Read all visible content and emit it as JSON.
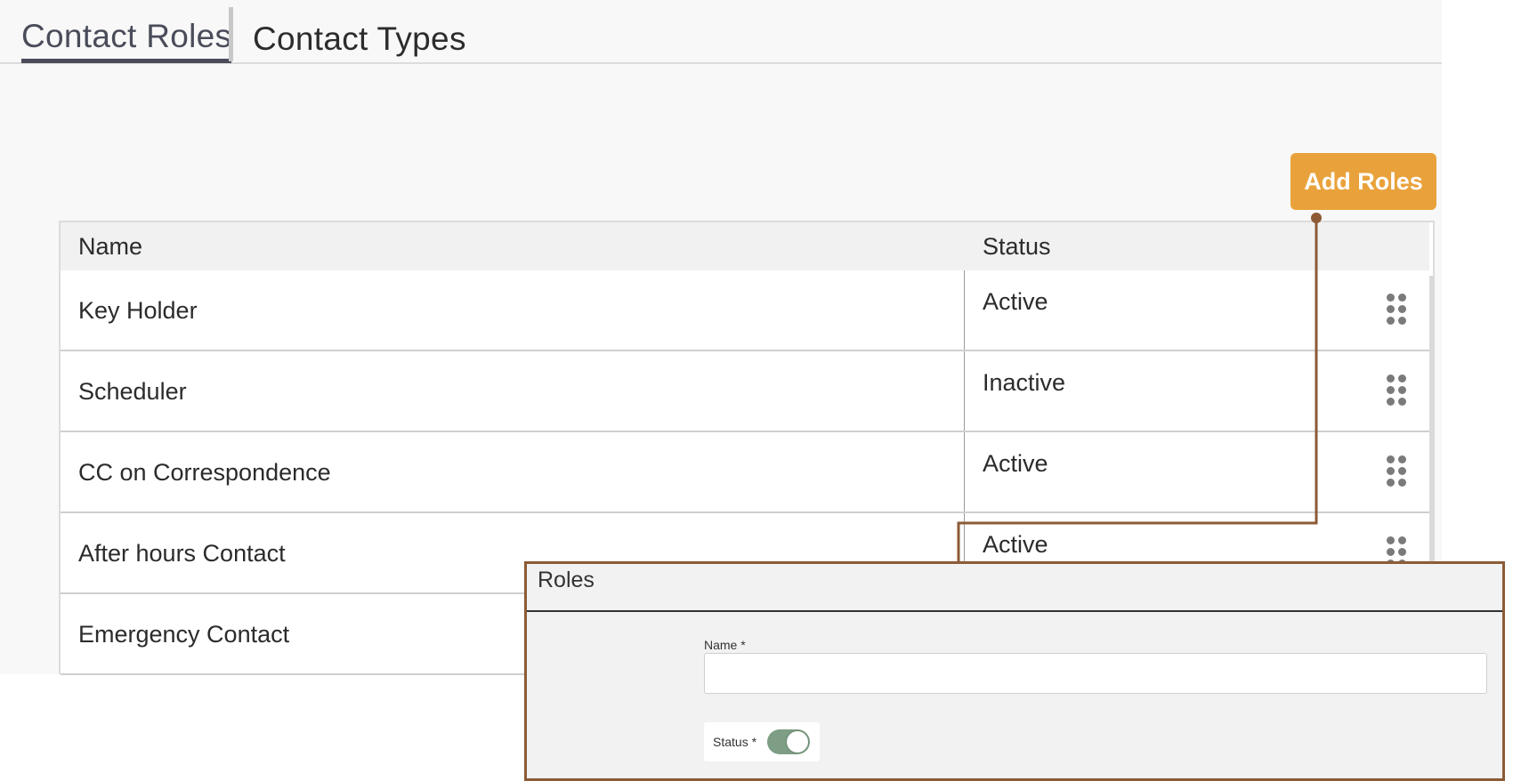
{
  "tabs": [
    {
      "label": "Contact Roles",
      "active": true
    },
    {
      "label": "Contact Types",
      "active": false
    }
  ],
  "toolbar": {
    "add_label": "Add Roles"
  },
  "table": {
    "headers": {
      "name": "Name",
      "status": "Status"
    },
    "rows": [
      {
        "name": "Key Holder",
        "status": "Active"
      },
      {
        "name": "Scheduler",
        "status": "Inactive"
      },
      {
        "name": "CC on Correspondence",
        "status": "Active"
      },
      {
        "name": "After hours Contact",
        "status": "Active"
      },
      {
        "name": "Emergency Contact",
        "status": ""
      }
    ]
  },
  "dialog": {
    "title": "Roles",
    "name_label": "Name *",
    "name_value": "",
    "status_label": "Status *",
    "status_on": true
  },
  "colors": {
    "accent": "#e9a23b",
    "callout": "#8c5b36",
    "toggle": "#7d9e84"
  },
  "icons": {
    "drag": "drag-handle-icon"
  }
}
